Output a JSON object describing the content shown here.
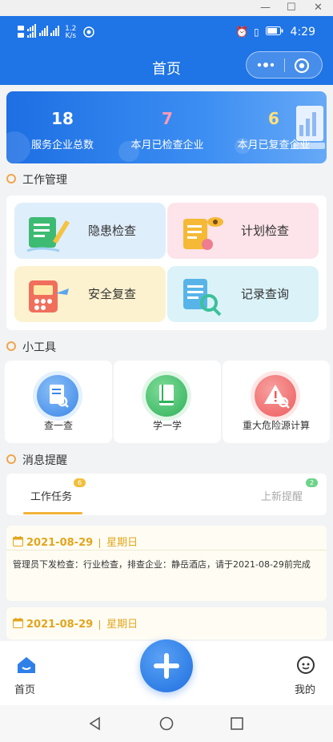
{
  "status_bar": {
    "net_speed_value": "1.2",
    "net_speed_unit": "K/s",
    "time": "4:29"
  },
  "nav": {
    "title": "首页"
  },
  "stats": [
    {
      "value": "18",
      "label": "服务企业总数",
      "color": "#ffffff"
    },
    {
      "value": "7",
      "label": "本月已检查企业",
      "color": "#ff9bb5"
    },
    {
      "value": "6",
      "label": "本月已复查企业",
      "color": "#ffe17a"
    }
  ],
  "sections": {
    "work": "工作管理",
    "tools": "小工具",
    "messages": "消息提醒"
  },
  "work_items": [
    {
      "label": "隐患检查",
      "bg": "#dfeefb"
    },
    {
      "label": "计划检查",
      "bg": "#fde3ea"
    },
    {
      "label": "安全复查",
      "bg": "#fdf2cf"
    },
    {
      "label": "记录查询",
      "bg": "#dbf3f8"
    }
  ],
  "tools": [
    {
      "label": "查一查",
      "color": "#3a86e8"
    },
    {
      "label": "学一学",
      "color": "#2fb15a"
    },
    {
      "label": "重大危险源计算",
      "color": "#ee5b5b"
    }
  ],
  "message_tabs": [
    {
      "label": "工作任务",
      "badge": "6",
      "active": true
    },
    {
      "label": "上新提醒",
      "badge": "2",
      "active": false
    }
  ],
  "messages": [
    {
      "date": "2021-08-29",
      "weekday": "星期日",
      "text": "管理员下发检查：行业检查，排查企业：静岳酒店，请于2021-08-29前完成"
    },
    {
      "date": "2021-08-29",
      "weekday": "星期日",
      "text": ""
    }
  ],
  "bottom_nav": {
    "home": "首页",
    "mine": "我的"
  }
}
